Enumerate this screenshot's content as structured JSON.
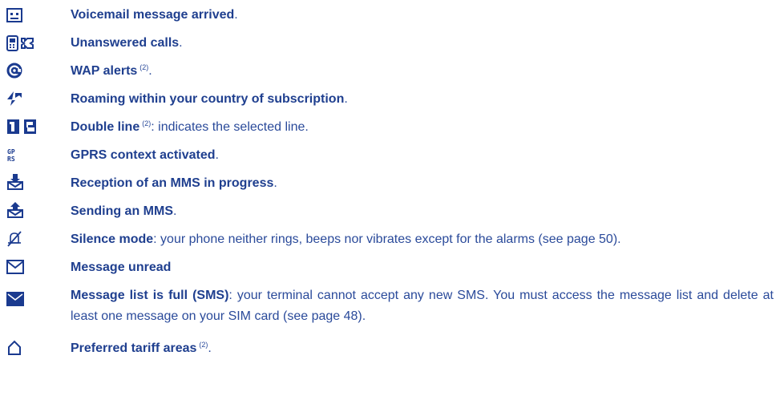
{
  "items": [
    {
      "icon": "voicemail-icon",
      "title": "Voicemail message arrived",
      "note": "",
      "sep": "",
      "desc": "",
      "end": "."
    },
    {
      "icon": "unanswered-calls-icon",
      "title": "Unanswered calls",
      "note": "",
      "sep": "",
      "desc": "",
      "end": "."
    },
    {
      "icon": "wap-alert-icon",
      "title": "WAP alerts",
      "note": "(2)",
      "sep": "",
      "desc": "",
      "end": "."
    },
    {
      "icon": "roaming-icon",
      "title": "Roaming within your country of subscription",
      "note": "",
      "sep": "",
      "desc": "",
      "end": "."
    },
    {
      "icon": "double-line-icon",
      "title": "Double line",
      "note": "(2)",
      "sep": ":",
      "desc": " indicates the selected line.",
      "end": ""
    },
    {
      "icon": "gprs-icon",
      "title": "GPRS context activated",
      "note": "",
      "sep": "",
      "desc": "",
      "end": "."
    },
    {
      "icon": "mms-receive-icon",
      "title": "Reception of an MMS in progress",
      "note": "",
      "sep": "",
      "desc": "",
      "end": "."
    },
    {
      "icon": "mms-send-icon",
      "title": "Sending an MMS",
      "note": "",
      "sep": "",
      "desc": "",
      "end": "."
    },
    {
      "icon": "silence-mode-icon",
      "title": "Silence mode",
      "note": "",
      "sep": ":",
      "desc": " your phone neither rings, beeps nor vibrates except for the alarms (see page 50).",
      "end": ""
    },
    {
      "icon": "message-unread-icon",
      "title": "Message unread",
      "note": "",
      "sep": "",
      "desc": "",
      "end": ""
    },
    {
      "icon": "message-list-full-icon",
      "title": "Message list is full (SMS)",
      "note": "",
      "sep": ":",
      "desc": " your terminal cannot accept any new SMS. You must access the message list and delete at least one message on your SIM card (see page 48).",
      "end": ""
    },
    {
      "icon": "preferred-tariff-icon",
      "title": "Preferred tariff areas",
      "note": "(2)",
      "sep": "",
      "desc": "",
      "end": "."
    }
  ],
  "colors": {
    "title": "#1f3f8f",
    "text": "#2a4a9a",
    "icon": "#1a3a8f"
  }
}
